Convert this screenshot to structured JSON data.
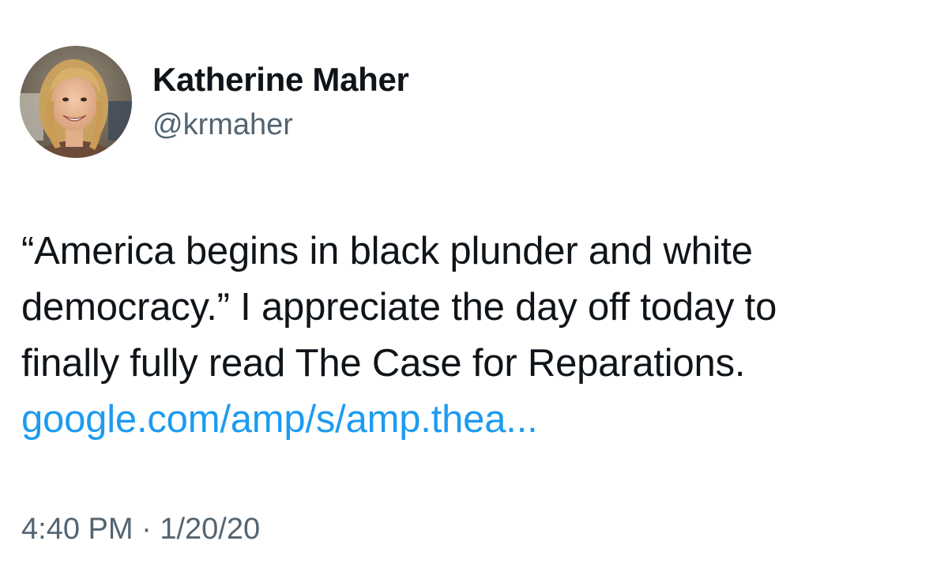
{
  "author": {
    "display_name": "Katherine Maher",
    "handle": "@krmaher"
  },
  "tweet": {
    "text_lines": [
      "“America begins in black plunder and white",
      "democracy.” I appreciate the day off today to",
      "finally fully read The Case for Reparations."
    ],
    "link_text": "google.com/amp/s/amp.thea..."
  },
  "meta": {
    "time": "4:40 PM",
    "separator": "·",
    "date": "1/20/20"
  },
  "colors": {
    "text": "#0f1419",
    "secondary": "#536471",
    "link": "#1d9bf0",
    "background": "#ffffff"
  }
}
